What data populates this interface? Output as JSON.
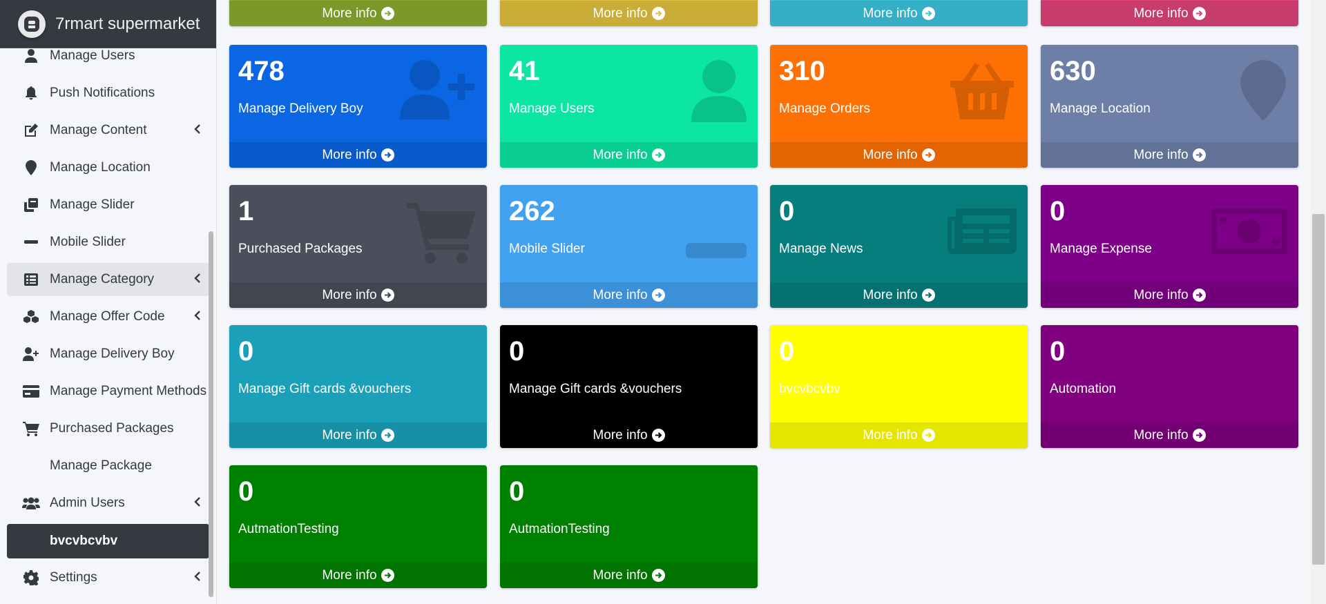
{
  "brand": {
    "name": "7rmart supermarket"
  },
  "sidebar": {
    "items": [
      {
        "label": "Manage Users",
        "icon": "user-icon",
        "chevron": false
      },
      {
        "label": "Push Notifications",
        "icon": "bell-icon",
        "chevron": false
      },
      {
        "label": "Manage Content",
        "icon": "edit-icon",
        "chevron": true
      },
      {
        "label": "Manage Location",
        "icon": "map-marker-icon",
        "chevron": false
      },
      {
        "label": "Manage Slider",
        "icon": "clone-icon",
        "chevron": false
      },
      {
        "label": "Mobile Slider",
        "icon": "minus-icon",
        "chevron": false
      },
      {
        "label": "Manage Category",
        "icon": "list-alt-icon",
        "chevron": true,
        "state": "hover"
      },
      {
        "label": "Manage Offer Code",
        "icon": "cubes-icon",
        "chevron": true
      },
      {
        "label": "Manage Delivery Boy",
        "icon": "user-plus-icon",
        "chevron": false
      },
      {
        "label": "Manage Payment Methods",
        "icon": "credit-card-icon",
        "chevron": false
      },
      {
        "label": "Purchased Packages",
        "icon": "shopping-cart-icon",
        "chevron": false
      },
      {
        "label": "Manage Package",
        "icon": "",
        "chevron": false
      },
      {
        "label": "Admin Users",
        "icon": "users-icon",
        "chevron": true
      },
      {
        "label": "bvcvbcvbv",
        "icon": "",
        "chevron": false,
        "state": "active"
      },
      {
        "label": "Settings",
        "icon": "cog-icon",
        "chevron": true
      }
    ]
  },
  "more_info_label": "More info",
  "top_row": [
    {
      "color": "#8aab2e",
      "footer": "More info"
    },
    {
      "color": "#e0c13e",
      "footer": "More info"
    },
    {
      "color": "#3cc3dc",
      "footer": "More info"
    },
    {
      "color": "#df427a",
      "footer": "More info"
    }
  ],
  "boxes": [
    {
      "number": "478",
      "label": "Manage Delivery Boy",
      "color": "#0b66e4",
      "icon": "user-plus-icon"
    },
    {
      "number": "41",
      "label": "Manage Users",
      "color": "#0be6a0",
      "icon": "user-icon"
    },
    {
      "number": "310",
      "label": "Manage Orders",
      "color": "#fd7003",
      "icon": "basket-icon"
    },
    {
      "number": "630",
      "label": "Manage Location",
      "color": "#6d7fa7",
      "icon": "map-marker-icon"
    },
    {
      "number": "1",
      "label": "Purchased Packages",
      "color": "#4a4f5b",
      "icon": "shopping-cart-icon"
    },
    {
      "number": "262",
      "label": "Mobile Slider",
      "color": "#42a1f1",
      "icon": "minus-icon"
    },
    {
      "number": "0",
      "label": "Manage News",
      "color": "#077e7e",
      "icon": "newspaper-icon"
    },
    {
      "number": "0",
      "label": "Manage Expense",
      "color": "#7f0088",
      "icon": "money-bill-icon"
    },
    {
      "number": "0",
      "label": "Manage Gift cards &vouchers",
      "color": "#1aa0b8",
      "icon": ""
    },
    {
      "number": "0",
      "label": "Manage Gift cards &vouchers",
      "color": "#000000",
      "icon": ""
    },
    {
      "number": "0",
      "label": "bvcvbcvbv",
      "color": "#ffff00",
      "icon": ""
    },
    {
      "number": "0",
      "label": "Automation",
      "color": "#800080",
      "icon": ""
    },
    {
      "number": "0",
      "label": "AutmationTesting",
      "color": "#008000",
      "icon": ""
    },
    {
      "number": "0",
      "label": "AutmationTesting",
      "color": "#008000",
      "icon": ""
    }
  ]
}
